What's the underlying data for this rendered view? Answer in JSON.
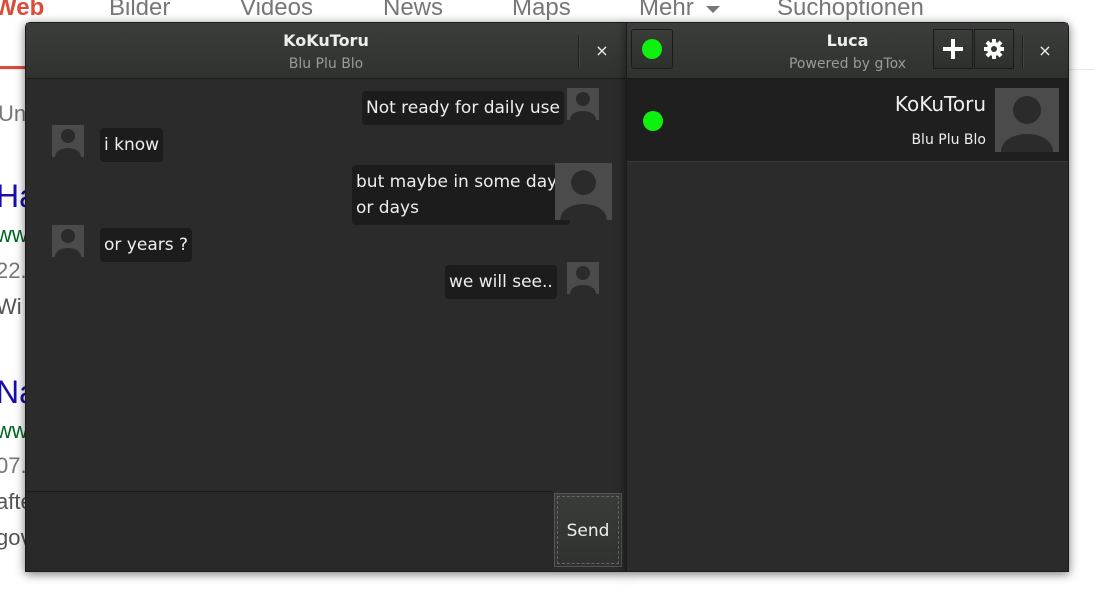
{
  "background": {
    "tabs": [
      "Web",
      "Bilder",
      "Videos",
      "News",
      "Maps",
      "Mehr",
      "Suchoptionen"
    ],
    "fragments": [
      "Un",
      "Ha",
      "ww",
      "22.",
      "Wi",
      "Na",
      "ww",
      "07.",
      "afte",
      "gov"
    ]
  },
  "chat": {
    "title": "KoKuToru",
    "subtitle": "Blu Plu Blo",
    "close_label": "×",
    "messages": [
      {
        "side": "right",
        "text": "Not ready for daily use"
      },
      {
        "side": "left",
        "text": "i know"
      },
      {
        "side": "right",
        "lines": [
          "but maybe in some days",
          "or days"
        ]
      },
      {
        "side": "left",
        "text": "or years ?"
      },
      {
        "side": "right",
        "text": "we will see.."
      }
    ],
    "input_value": "",
    "send_label": "Send"
  },
  "contacts": {
    "title": "Luca",
    "subtitle": "Powered by gTox",
    "close_label": "×",
    "add_icon": "plus-icon",
    "settings_icon": "gear-icon",
    "status_color": "#0ef10e",
    "list": [
      {
        "name": "KoKuToru",
        "status": "Blu Plu Blo",
        "online": true
      }
    ]
  }
}
